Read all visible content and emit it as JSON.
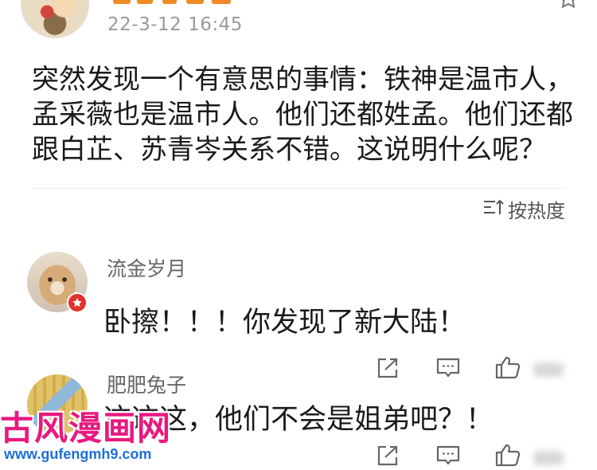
{
  "post": {
    "timestamp": "22-3-12 16:45",
    "text_lines": [
      "突然发现一个有意思的事情：铁神是温市人，",
      "孟采薇也是温市人。他们还都姓孟。他们还都",
      "跟白芷、苏青岑关系不错。这说明什么呢？"
    ],
    "avatar_icon": "user-avatar"
  },
  "sort": {
    "label": "按热度",
    "icon": "sort-icon"
  },
  "comments": [
    {
      "name": "流金岁月",
      "text": "卧擦！！！你发现了新大陆！",
      "avatar_icon": "cat-avatar",
      "badge_icon": "star-badge-icon"
    },
    {
      "name": "肥肥兔子",
      "text": "这这这，他们不会是姐弟吧？！",
      "avatar_icon": "user-avatar"
    }
  ],
  "actions": {
    "share_icon": "share-icon",
    "comment_icon": "comment-icon",
    "like_icon": "like-icon"
  },
  "watermark": {
    "site_name": "古风漫画网",
    "url": "www.gufengmh9.com"
  },
  "colors": {
    "author_name": "#f08a24",
    "text": "#1a1a1a",
    "meta": "#9a9a9a",
    "icon": "#666666",
    "watermark_pink": "#e8197f",
    "watermark_blue": "#1e6fd8"
  }
}
